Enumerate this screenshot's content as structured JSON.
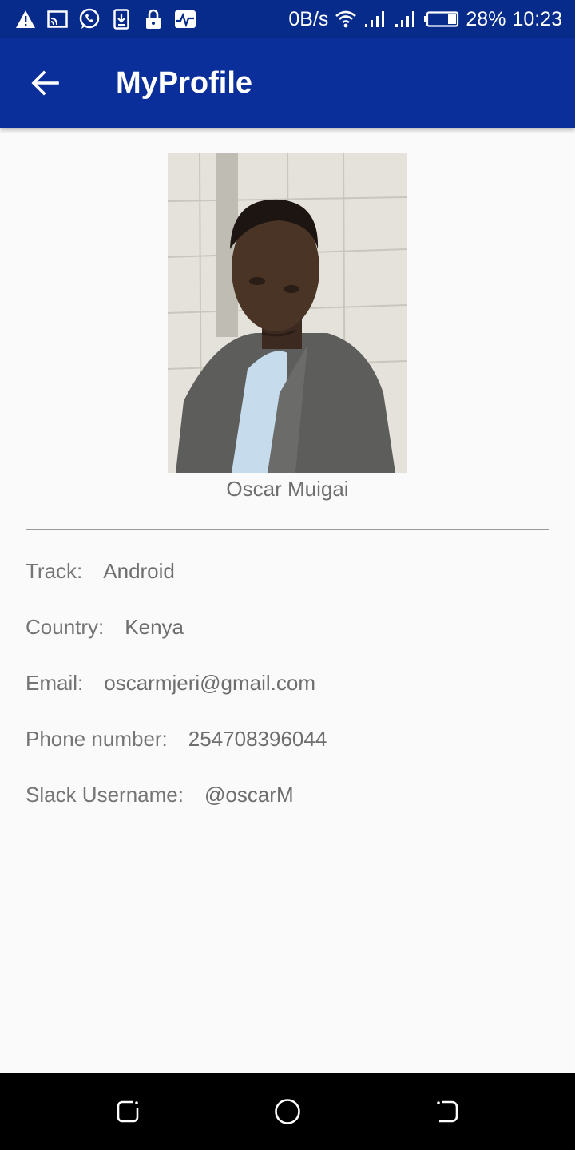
{
  "status_bar": {
    "net_speed": "0B/s",
    "battery": "28%",
    "time": "10:23",
    "icons": [
      "warning-icon",
      "cast-icon",
      "whatsapp-icon",
      "download-icon",
      "lock-icon",
      "pulse-icon",
      "wifi-icon",
      "signal-icon",
      "signal-icon",
      "battery-icon"
    ]
  },
  "app_bar": {
    "title": "MyProfile",
    "back_icon": "arrow-back-icon",
    "color": "#0a2f9a"
  },
  "profile": {
    "name": "Oscar Muigai",
    "fields": [
      {
        "label": "Track:",
        "value": "Android"
      },
      {
        "label": "Country:",
        "value": "Kenya"
      },
      {
        "label": "Email:",
        "value": "oscarmjeri@gmail.com"
      },
      {
        "label": "Phone number:",
        "value": "254708396044"
      },
      {
        "label": "Slack Username:",
        "value": "@oscarM"
      }
    ]
  },
  "nav_bar": {
    "icons": [
      "recents-icon",
      "home-icon",
      "back-icon"
    ]
  }
}
